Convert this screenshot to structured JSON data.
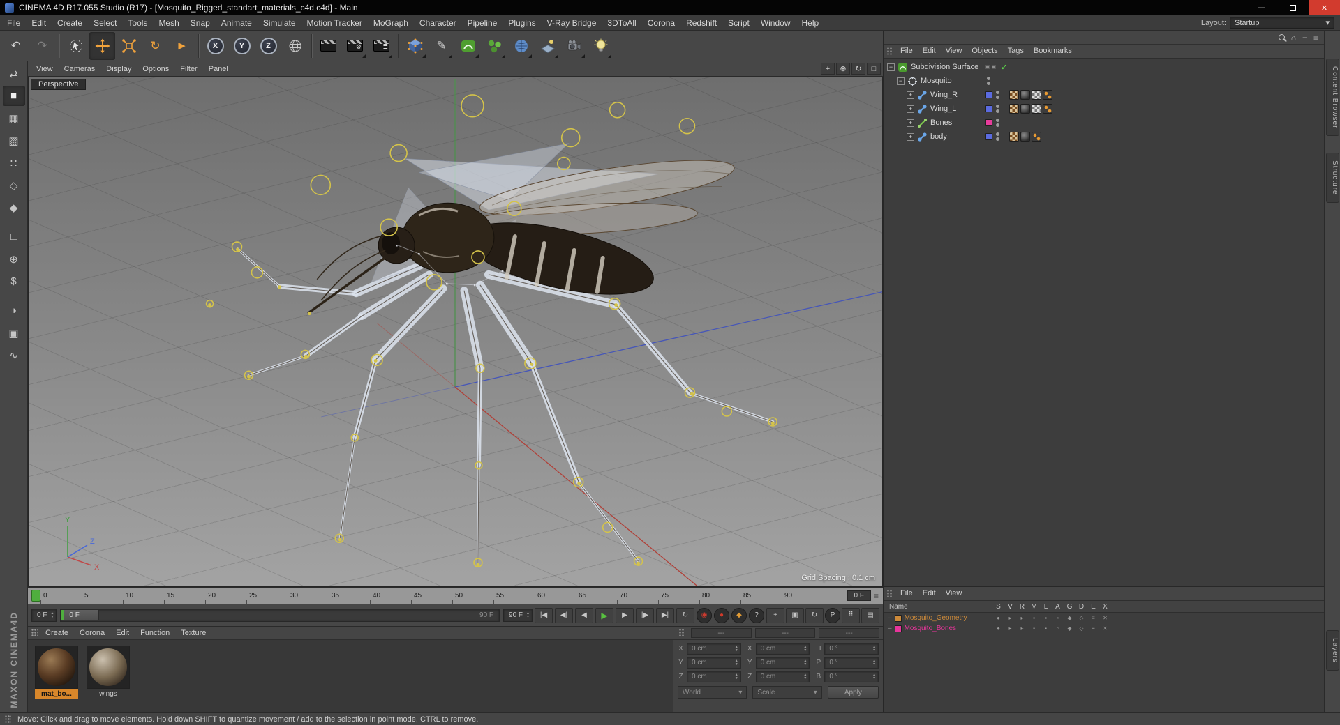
{
  "colors": {
    "close_red": "#d23b2e",
    "selection_orange": "#d8872b",
    "timeline_green": "#4fae3e",
    "play_green": "#58c040",
    "icon_orange": "#f0a23c"
  },
  "icons": {
    "minimize": "—",
    "close": "✕",
    "dropdown": "▾",
    "undo": "↶",
    "redo": "↷",
    "rotate": "↻",
    "last_tool": "►",
    "gear": "⚙",
    "queue_lines": "≣",
    "pen": "✎",
    "go_start": "|◀",
    "prev_key": "◀|",
    "prev_frame": "◀",
    "play": "▶",
    "next_frame": "▶",
    "next_key": "|▶",
    "go_end": "▶|",
    "loop": "↻",
    "record": "◉",
    "autokey": "●",
    "keyframe": "◆",
    "help": "?",
    "mini_move": "+",
    "mini_scale": "▣",
    "mini_rotate": "↻",
    "p_badge": "P",
    "dots_grid": "⠿",
    "panel_toggle": "▤",
    "home": "⌂",
    "hamburger": "≡",
    "nav_pan": "+",
    "nav_zoom": "⊕",
    "nav_rotate": "↻",
    "nav_switch": "□",
    "stepper_up": "▲",
    "stepper_down": "▼",
    "plus": "+",
    "minus": "−",
    "check": "✓",
    "tree_dash": "–"
  },
  "titlebar": {
    "title": "CINEMA 4D R17.055 Studio (R17) - [Mosquito_Rigged_standart_materials_c4d.c4d] - Main"
  },
  "menubar": {
    "items": [
      "File",
      "Edit",
      "Create",
      "Select",
      "Tools",
      "Mesh",
      "Snap",
      "Animate",
      "Simulate",
      "Motion Tracker",
      "MoGraph",
      "Character",
      "Pipeline",
      "Plugins",
      "V-Ray Bridge",
      "3DToAll",
      "Corona",
      "Redshift",
      "Script",
      "Window",
      "Help"
    ],
    "layout_label": "Layout:",
    "layout_value": "Startup"
  },
  "toolbar": {
    "axis_x": "X",
    "axis_y": "Y",
    "axis_z": "Z"
  },
  "leftbar": {
    "tools": [
      {
        "name": "make-editable",
        "glyph": "⇄"
      },
      {
        "name": "model-mode",
        "glyph": "■"
      },
      {
        "name": "texture-mode",
        "glyph": "▦"
      },
      {
        "name": "workplane-mode",
        "glyph": "▨"
      },
      {
        "name": "points-mode",
        "glyph": "∷"
      },
      {
        "name": "edges-mode",
        "glyph": "◇"
      },
      {
        "name": "polygons-mode",
        "glyph": "◆"
      },
      {
        "name": "axis-mode",
        "glyph": "∟"
      },
      {
        "name": "object-axis-mode",
        "glyph": "⊕"
      },
      {
        "name": "snap-mode",
        "glyph": "$"
      },
      {
        "name": "paint-mode",
        "glyph": "◑"
      },
      {
        "name": "lock-mode",
        "glyph": "▣"
      },
      {
        "name": "coil-mode",
        "glyph": "∿"
      }
    ]
  },
  "branding": {
    "vertical": "MAXON CINEMA4D"
  },
  "viewport": {
    "menu": [
      "View",
      "Cameras",
      "Display",
      "Options",
      "Filter",
      "Panel"
    ],
    "camera_label": "Perspective",
    "grid_spacing": "Grid Spacing : 0.1 cm",
    "axis": {
      "x": "X",
      "y": "Y",
      "z": "Z"
    }
  },
  "object_manager": {
    "menu": [
      "File",
      "Edit",
      "View",
      "Objects",
      "Tags",
      "Bookmarks"
    ],
    "items": [
      {
        "label": "Subdivision Surface"
      },
      {
        "label": "Mosquito"
      },
      {
        "label": "Wing_R",
        "color": "#5b6be0"
      },
      {
        "label": "Wing_L",
        "color": "#5b6be0"
      },
      {
        "label": "Bones",
        "color": "#e83c9c"
      },
      {
        "label": "body",
        "color": "#5b6be0"
      }
    ]
  },
  "layer_manager": {
    "menu": [
      "File",
      "Edit",
      "View"
    ],
    "name_header": "Name",
    "columns": [
      "S",
      "V",
      "R",
      "M",
      "L",
      "A",
      "G",
      "D",
      "E",
      "X"
    ],
    "cell_glyphs": [
      "●",
      "▸",
      "▸",
      "▪",
      "▪",
      "▫",
      "◆",
      "◇",
      "≡",
      "✕"
    ],
    "rows": [
      {
        "label": "Mosquito_Geometry",
        "color": "#cd8a3a"
      },
      {
        "label": "Mosquito_Bones",
        "color": "#e8359b"
      }
    ]
  },
  "right_tabs": {
    "tabs": [
      "Content Browser",
      "Structure",
      "Layers"
    ]
  },
  "timeline": {
    "ticks": [
      "0",
      "5",
      "10",
      "15",
      "20",
      "25",
      "30",
      "35",
      "40",
      "45",
      "50",
      "55",
      "60",
      "65",
      "70",
      "75",
      "80",
      "85",
      "90"
    ],
    "current_frame": "0 F",
    "range_start": "0 F",
    "range_end": "90 F",
    "end_frame": "90 F"
  },
  "materials": {
    "menu": [
      "Create",
      "Corona",
      "Edit",
      "Function",
      "Texture"
    ],
    "items": [
      {
        "label": "mat_bo..."
      },
      {
        "label": "wings"
      }
    ]
  },
  "coordinates": {
    "headers": [
      "---",
      "---",
      "---"
    ],
    "rows": [
      {
        "pos_label": "X",
        "pos": "0 cm",
        "size_label": "X",
        "size": "0 cm",
        "rot_label": "H",
        "rot": "0 °"
      },
      {
        "pos_label": "Y",
        "pos": "0 cm",
        "size_label": "Y",
        "size": "0 cm",
        "rot_label": "P",
        "rot": "0 °"
      },
      {
        "pos_label": "Z",
        "pos": "0 cm",
        "size_label": "Z",
        "size": "0 cm",
        "rot_label": "B",
        "rot": "0 °"
      }
    ],
    "system": "World",
    "mode": "Scale",
    "apply": "Apply"
  },
  "statusbar": {
    "text": "Move: Click and drag to move elements. Hold down SHIFT to quantize movement / add to the selection in point mode, CTRL to remove."
  }
}
